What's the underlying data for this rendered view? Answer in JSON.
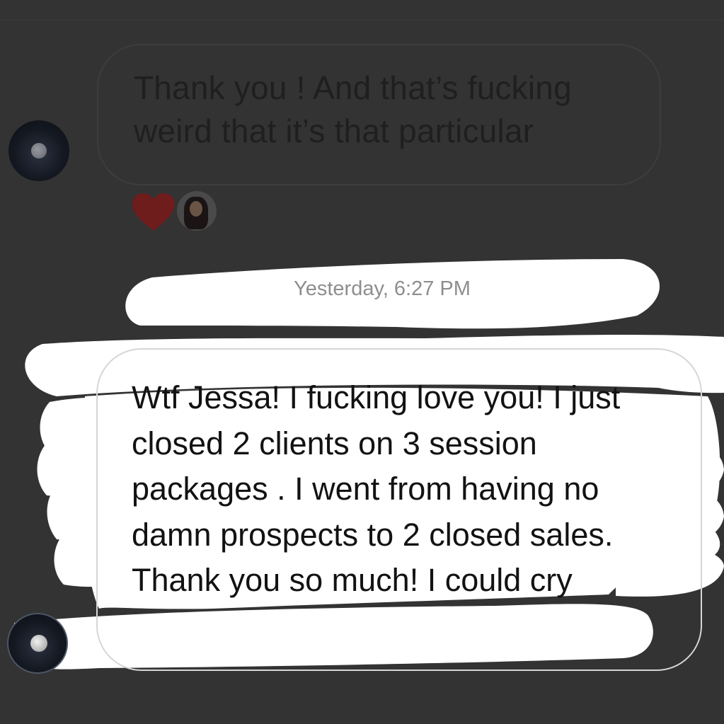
{
  "conversation": {
    "messages": [
      {
        "direction": "received",
        "text": "Thank you ! And that’s fucking weird that it’s that particular",
        "reaction": "heart-icon"
      },
      {
        "direction": "received",
        "timestamp": "Yesterday, 6:27 PM",
        "text": "Wtf Jessa! I fucking love you! I just closed 2 clients on 3 session packages . I went from having no damn prospects to 2 closed sales. Thank you so much! I could cry"
      }
    ]
  },
  "colors": {
    "background": "#333333",
    "highlight": "#ffffff",
    "reaction_heart": "#7a1f1f",
    "timestamp": "#8e8e8e"
  }
}
